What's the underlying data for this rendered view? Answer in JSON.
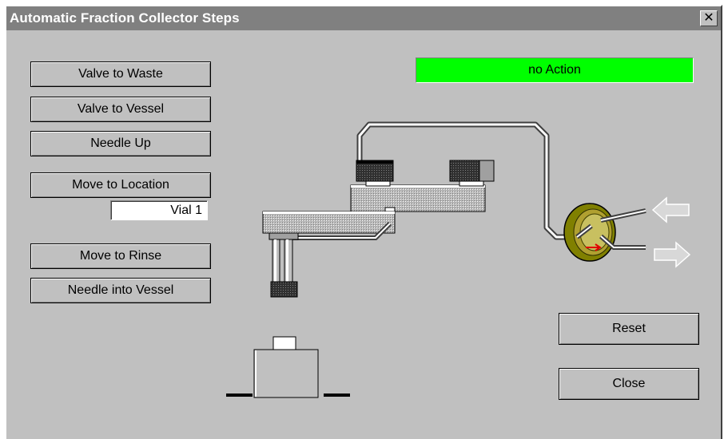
{
  "window": {
    "title": "Automatic Fraction Collector Steps",
    "close_glyph": "✕"
  },
  "buttons": {
    "valve_to_waste": "Valve to Waste",
    "valve_to_vessel": "Valve to Vessel",
    "needle_up": "Needle Up",
    "move_to_location": "Move to Location",
    "move_to_rinse": "Move to Rinse",
    "needle_into_vessel": "Needle into Vessel",
    "reset": "Reset",
    "close": "Close"
  },
  "location_field": {
    "value": "Vial 1"
  },
  "status": {
    "text": "no Action",
    "color": "#00ff00"
  },
  "icons": [
    "close-icon",
    "left-arrow-icon",
    "right-arrow-icon",
    "valve-icon"
  ]
}
